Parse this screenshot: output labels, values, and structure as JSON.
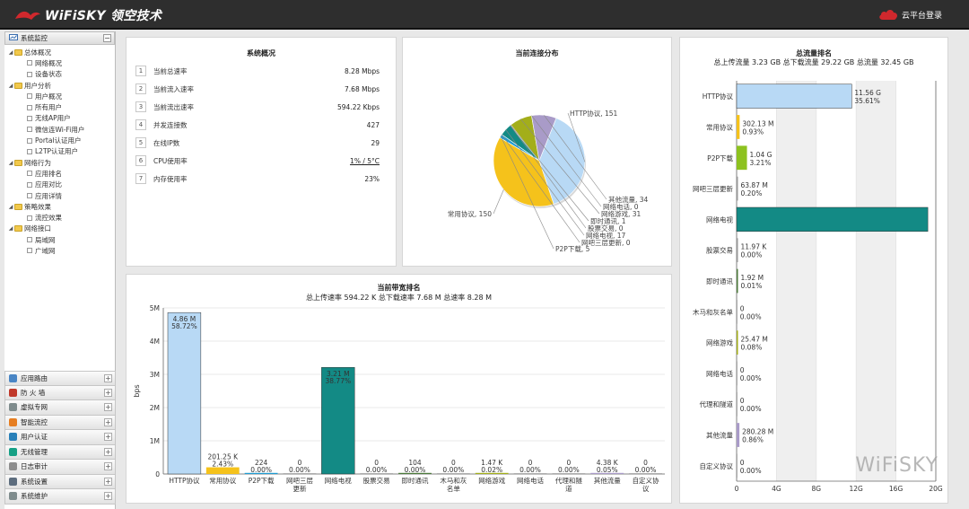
{
  "header": {
    "logo_text": "WiFiSKY 领空技术",
    "cloud_login": "云平台登录"
  },
  "sidebar": {
    "tree_title": "系统监控",
    "tree": [
      {
        "level": 1,
        "label": "总体概况"
      },
      {
        "level": 2,
        "label": "网络概况"
      },
      {
        "level": 2,
        "label": "设备状态"
      },
      {
        "level": 1,
        "label": "用户分析"
      },
      {
        "level": 2,
        "label": "用户概况"
      },
      {
        "level": 2,
        "label": "所有用户"
      },
      {
        "level": 2,
        "label": "无线AP用户"
      },
      {
        "level": 2,
        "label": "微信连Wi-Fi用户"
      },
      {
        "level": 2,
        "label": "Portal认证用户"
      },
      {
        "level": 2,
        "label": "L2TP认证用户"
      },
      {
        "level": 1,
        "label": "网络行为"
      },
      {
        "level": 2,
        "label": "应用排名"
      },
      {
        "level": 2,
        "label": "应用对比"
      },
      {
        "level": 2,
        "label": "应用详情"
      },
      {
        "level": 1,
        "label": "策略效果"
      },
      {
        "level": 2,
        "label": "流控效果"
      },
      {
        "level": 1,
        "label": "网络接口"
      },
      {
        "level": 2,
        "label": "局域网"
      },
      {
        "level": 2,
        "label": "广域网"
      }
    ],
    "menu": [
      {
        "label": "应用路由",
        "color": "#4a86c5"
      },
      {
        "label": "防 火 墙",
        "color": "#c0392b"
      },
      {
        "label": "虚拟专网",
        "color": "#7f8c8d"
      },
      {
        "label": "智能流控",
        "color": "#e67e22"
      },
      {
        "label": "用户认证",
        "color": "#2980b9"
      },
      {
        "label": "无线管理",
        "color": "#16a085"
      },
      {
        "label": "日志审计",
        "color": "#8e8e8e"
      },
      {
        "label": "系统设置",
        "color": "#5d6d7e"
      },
      {
        "label": "系统维护",
        "color": "#7f8c8d"
      }
    ]
  },
  "overview": {
    "title": "系统概况",
    "rows": [
      {
        "num": "1",
        "label": "当前总速率",
        "value": "8.28 Mbps"
      },
      {
        "num": "2",
        "label": "当前流入速率",
        "value": "7.68 Mbps"
      },
      {
        "num": "3",
        "label": "当前流出速率",
        "value": "594.22 Kbps"
      },
      {
        "num": "4",
        "label": "并发连接数",
        "value": "427"
      },
      {
        "num": "5",
        "label": "在线IP数",
        "value": "29"
      },
      {
        "num": "6",
        "label": "CPU使用率",
        "value": "1% / 5°C"
      },
      {
        "num": "7",
        "label": "内存使用率",
        "value": "23%"
      }
    ]
  },
  "connections": {
    "title": "当前连接分布",
    "chart_data": {
      "type": "pie",
      "slices": [
        {
          "label": "HTTP协议, 151",
          "value": 151,
          "color": "#b8d9f5"
        },
        {
          "label": "常用协议, 150",
          "value": 150,
          "color": "#f5c21b"
        },
        {
          "label": "P2P下载, 5",
          "value": 5,
          "color": "#1f9bd1"
        },
        {
          "label": "网吧三层更新, 0",
          "value": 0,
          "color": "#999999"
        },
        {
          "label": "网络电视, 17",
          "value": 17,
          "color": "#138a85"
        },
        {
          "label": "股票交易, 0",
          "value": 0,
          "color": "#999999"
        },
        {
          "label": "即时通讯, 1",
          "value": 1,
          "color": "#4c7a3b"
        },
        {
          "label": "网络游戏, 31",
          "value": 31,
          "color": "#a3ae1a"
        },
        {
          "label": "网络电话, 0",
          "value": 0,
          "color": "#999999"
        },
        {
          "label": "其他流量, 34",
          "value": 34,
          "color": "#a99bc8"
        }
      ]
    }
  },
  "bandwidth": {
    "title": "当前带宽排名",
    "subtitle": "总上传速率 594.22 K 总下载速率 7.68 M 总速率 8.28 M",
    "chart_data": {
      "type": "bar",
      "ylabel": "bps",
      "ylim": [
        0,
        5000000
      ],
      "yticks": [
        "0",
        "1M",
        "2M",
        "3M",
        "4M",
        "5M"
      ],
      "categories": [
        "HTTP协议",
        "常用协议",
        "P2P下载",
        "网吧三层\n更新",
        "网络电视",
        "股票交易",
        "即时通讯",
        "木马和灰\n名单",
        "网络游戏",
        "网络电话",
        "代理和隧\n道",
        "其他流量",
        "自定义协\n议"
      ],
      "values": [
        4860000,
        201250,
        224,
        0,
        3210000,
        0,
        104,
        0,
        1470,
        0,
        0,
        4380,
        0
      ],
      "value_labels": [
        "4.86 M",
        "201.25 K",
        "224",
        "0",
        "3.21 M",
        "0",
        "104",
        "0",
        "1.47 K",
        "0",
        "0",
        "4.38 K",
        "0"
      ],
      "pct_labels": [
        "58.72%",
        "2.43%",
        "0.00%",
        "0.00%",
        "38.77%",
        "0.00%",
        "0.00%",
        "0.00%",
        "0.02%",
        "0.00%",
        "0.00%",
        "0.05%",
        "0.00%"
      ],
      "colors": [
        "#b8d9f5",
        "#f5c21b",
        "#1f9bd1",
        "#999999",
        "#138a85",
        "#999999",
        "#4c7a3b",
        "#999999",
        "#a3ae1a",
        "#999999",
        "#999999",
        "#a99bc8",
        "#999999"
      ]
    }
  },
  "traffic": {
    "title": "总流量排名",
    "subtitle": "总上传流量 3.23 GB 总下载流量 29.22 GB 总流量 32.45 GB",
    "chart_data": {
      "type": "bar",
      "orientation": "horizontal",
      "xlim": [
        0,
        20
      ],
      "xunit": "G",
      "xticks": [
        "0",
        "4G",
        "8G",
        "12G",
        "16G",
        "20G"
      ],
      "categories": [
        "HTTP协议",
        "常用协议",
        "P2P下载",
        "网吧三层更新",
        "网络电视",
        "股票交易",
        "即时通讯",
        "木马和灰名单",
        "网络游戏",
        "网络电话",
        "代理和隧道",
        "其他流量",
        "自定义协议"
      ],
      "values": [
        11.56,
        0.302,
        1.04,
        0.0639,
        19.2,
        1.2e-05,
        1.9e-06,
        0,
        2.55e-05,
        0,
        0,
        0.28,
        0
      ],
      "value_labels": [
        "11.56 G",
        "302.13 M",
        "1.04 G",
        "63.87 M",
        "",
        "11.97 K",
        "1.92 M",
        "0",
        "25.47 M",
        "0",
        "0",
        "280.28 M",
        "0"
      ],
      "pct_labels": [
        "35.61%",
        "0.93%",
        "3.21%",
        "0.20%",
        "",
        "0.00%",
        "0.01%",
        "0.00%",
        "0.08%",
        "0.00%",
        "0.00%",
        "0.86%",
        "0.00%"
      ],
      "colors": [
        "#b8d9f5",
        "#f5c21b",
        "#8dc21f",
        "#999999",
        "#138a85",
        "#999999",
        "#4c7a3b",
        "#999999",
        "#a3ae1a",
        "#999999",
        "#999999",
        "#a99bc8",
        "#999999"
      ]
    }
  },
  "watermark": "WiFiSKY"
}
